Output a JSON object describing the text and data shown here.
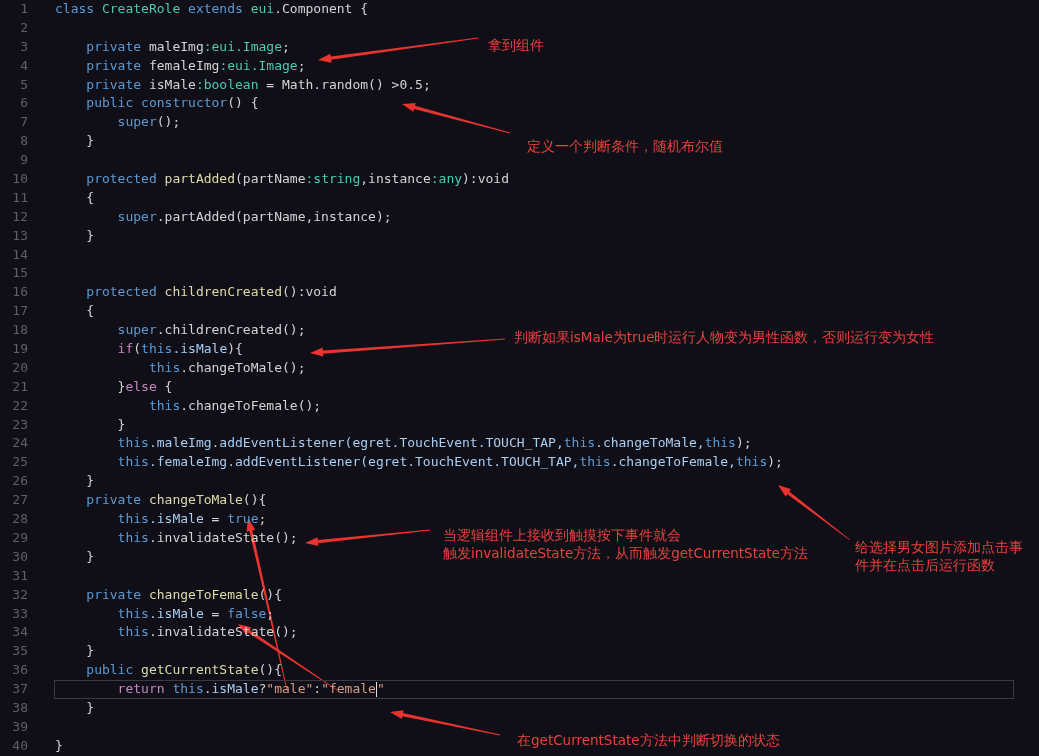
{
  "editor": {
    "lines": [
      {
        "number": "1",
        "current": false,
        "tokens": [
          {
            "kind": "keyword",
            "text": "class"
          },
          {
            "kind": "type",
            "text": " CreateRole"
          },
          {
            "kind": "keyword",
            "text": " extends"
          },
          {
            "kind": "type",
            "text": " eui"
          },
          {
            "kind": "plain",
            "text": ".Component {"
          }
        ]
      },
      {
        "number": "2",
        "current": false
      },
      {
        "number": "3",
        "current": false,
        "tokens": [
          {
            "kind": "keyword",
            "text": "    private"
          },
          {
            "kind": "plain",
            "text": " maleImg"
          },
          {
            "kind": "type",
            "text": ":eui.Image"
          },
          {
            "kind": "plain",
            "text": ";"
          }
        ]
      },
      {
        "number": "4",
        "current": false,
        "tokens": [
          {
            "kind": "keyword",
            "text": "    private"
          },
          {
            "kind": "plain",
            "text": " femaleImg"
          },
          {
            "kind": "type",
            "text": ":eui.Image"
          },
          {
            "kind": "plain",
            "text": ";"
          }
        ]
      },
      {
        "number": "5",
        "current": false,
        "tokens": [
          {
            "kind": "keyword",
            "text": "    private"
          },
          {
            "kind": "plain",
            "text": " isMale"
          },
          {
            "kind": "type",
            "text": ":boolean"
          },
          {
            "kind": "plain",
            "text": " = Math.random() >0.5;"
          }
        ]
      },
      {
        "number": "6",
        "current": false,
        "tokens": [
          {
            "kind": "keyword",
            "text": "    public constructor"
          },
          {
            "kind": "plain",
            "text": "() {"
          }
        ]
      },
      {
        "number": "7",
        "current": false,
        "tokens": [
          {
            "kind": "keyword",
            "text": "        super"
          },
          {
            "kind": "plain",
            "text": "();"
          }
        ]
      },
      {
        "number": "8",
        "current": false,
        "tokens": [
          {
            "kind": "plain",
            "text": "    }"
          }
        ]
      },
      {
        "number": "9",
        "current": false
      },
      {
        "number": "10",
        "current": false,
        "tokens": [
          {
            "kind": "keyword",
            "text": "    protected"
          },
          {
            "kind": "function",
            "text": " partAdded"
          },
          {
            "kind": "plain",
            "text": "(partName"
          },
          {
            "kind": "type",
            "text": ":string"
          },
          {
            "kind": "plain",
            "text": ",instance"
          },
          {
            "kind": "type",
            "text": ":any"
          },
          {
            "kind": "plain",
            "text": "):void"
          }
        ]
      },
      {
        "number": "11",
        "current": false,
        "tokens": [
          {
            "kind": "plain",
            "text": "    {"
          }
        ]
      },
      {
        "number": "12",
        "current": false,
        "tokens": [
          {
            "kind": "keyword",
            "text": "        super"
          },
          {
            "kind": "plain",
            "text": ".partAdded(partName,instance);"
          }
        ]
      },
      {
        "number": "13",
        "current": false,
        "tokens": [
          {
            "kind": "plain",
            "text": "    }"
          }
        ]
      },
      {
        "number": "14",
        "current": false
      },
      {
        "number": "15",
        "current": false
      },
      {
        "number": "16",
        "current": false,
        "tokens": [
          {
            "kind": "keyword",
            "text": "    protected"
          },
          {
            "kind": "function",
            "text": " childrenCreated"
          },
          {
            "kind": "plain",
            "text": "():void"
          }
        ]
      },
      {
        "number": "17",
        "current": false,
        "tokens": [
          {
            "kind": "plain",
            "text": "    {"
          }
        ]
      },
      {
        "number": "18",
        "current": false,
        "tokens": [
          {
            "kind": "keyword",
            "text": "        super"
          },
          {
            "kind": "plain",
            "text": ".childrenCreated();"
          }
        ]
      },
      {
        "number": "19",
        "current": false,
        "tokens": [
          {
            "kind": "control",
            "text": "        if"
          },
          {
            "kind": "plain",
            "text": "("
          },
          {
            "kind": "keyword",
            "text": "this"
          },
          {
            "kind": "variable",
            "text": ".isMale"
          },
          {
            "kind": "plain",
            "text": "){"
          }
        ]
      },
      {
        "number": "20",
        "current": false,
        "tokens": [
          {
            "kind": "keyword",
            "text": "            this"
          },
          {
            "kind": "plain",
            "text": ".changeToMale();"
          }
        ]
      },
      {
        "number": "21",
        "current": false,
        "tokens": [
          {
            "kind": "plain",
            "text": "        }"
          },
          {
            "kind": "control",
            "text": "else"
          },
          {
            "kind": "plain",
            "text": " {"
          }
        ]
      },
      {
        "number": "22",
        "current": false,
        "tokens": [
          {
            "kind": "keyword",
            "text": "            this"
          },
          {
            "kind": "plain",
            "text": ".changeToFemale();"
          }
        ]
      },
      {
        "number": "23",
        "current": false,
        "tokens": [
          {
            "kind": "plain",
            "text": "        }"
          }
        ]
      },
      {
        "number": "24",
        "current": false,
        "tokens": [
          {
            "kind": "keyword",
            "text": "        this"
          },
          {
            "kind": "variable",
            "text": ".maleImg.addEventListener(egret.TouchEvent.TOUCH_TAP,"
          },
          {
            "kind": "keyword",
            "text": "this"
          },
          {
            "kind": "variable",
            "text": ".changeToMale,"
          },
          {
            "kind": "keyword",
            "text": "this"
          },
          {
            "kind": "plain",
            "text": ");"
          }
        ]
      },
      {
        "number": "25",
        "current": false,
        "tokens": [
          {
            "kind": "keyword",
            "text": "        this"
          },
          {
            "kind": "variable",
            "text": ".femaleImg.addEventListener(egret.TouchEvent.TOUCH_TAP,"
          },
          {
            "kind": "keyword",
            "text": "this"
          },
          {
            "kind": "variable",
            "text": ".changeToFemale,"
          },
          {
            "kind": "keyword",
            "text": "this"
          },
          {
            "kind": "plain",
            "text": ");"
          }
        ]
      },
      {
        "number": "26",
        "current": false,
        "tokens": [
          {
            "kind": "plain",
            "text": "    }"
          }
        ]
      },
      {
        "number": "27",
        "current": false,
        "tokens": [
          {
            "kind": "keyword",
            "text": "    private"
          },
          {
            "kind": "function",
            "text": " changeToMale"
          },
          {
            "kind": "plain",
            "text": "(){"
          }
        ]
      },
      {
        "number": "28",
        "current": false,
        "tokens": [
          {
            "kind": "keyword",
            "text": "        this"
          },
          {
            "kind": "variable",
            "text": ".isMale"
          },
          {
            "kind": "plain",
            "text": " ="
          },
          {
            "kind": "keyword",
            "text": " true"
          },
          {
            "kind": "plain",
            "text": ";"
          }
        ]
      },
      {
        "number": "29",
        "current": false,
        "tokens": [
          {
            "kind": "keyword",
            "text": "        this"
          },
          {
            "kind": "plain",
            "text": ".invalidateState();"
          }
        ]
      },
      {
        "number": "30",
        "current": false,
        "tokens": [
          {
            "kind": "plain",
            "text": "    }"
          }
        ]
      },
      {
        "number": "31",
        "current": false
      },
      {
        "number": "32",
        "current": false,
        "tokens": [
          {
            "kind": "keyword",
            "text": "    private"
          },
          {
            "kind": "function",
            "text": " changeToFemale"
          },
          {
            "kind": "plain",
            "text": "(){"
          }
        ]
      },
      {
        "number": "33",
        "current": false,
        "tokens": [
          {
            "kind": "keyword",
            "text": "        this"
          },
          {
            "kind": "variable",
            "text": ".isMale"
          },
          {
            "kind": "plain",
            "text": " ="
          },
          {
            "kind": "keyword",
            "text": " false"
          },
          {
            "kind": "plain",
            "text": ";"
          }
        ]
      },
      {
        "number": "34",
        "current": false,
        "tokens": [
          {
            "kind": "keyword",
            "text": "        this"
          },
          {
            "kind": "plain",
            "text": ".invalidateState();"
          }
        ]
      },
      {
        "number": "35",
        "current": false,
        "tokens": [
          {
            "kind": "plain",
            "text": "    }"
          }
        ]
      },
      {
        "number": "36",
        "current": false,
        "tokens": [
          {
            "kind": "keyword",
            "text": "    public"
          },
          {
            "kind": "function",
            "text": " getCurrentState"
          },
          {
            "kind": "plain",
            "text": "(){"
          }
        ]
      },
      {
        "number": "37",
        "current": true,
        "tokens": [
          {
            "kind": "control",
            "text": "        return"
          },
          {
            "kind": "keyword",
            "text": " this"
          },
          {
            "kind": "variable",
            "text": ".isMale"
          },
          {
            "kind": "plain",
            "text": "?"
          },
          {
            "kind": "string",
            "text": "\"male\""
          },
          {
            "kind": "plain",
            "text": ":"
          },
          {
            "kind": "string",
            "text": "\"female"
          },
          {
            "kind": "caret"
          },
          {
            "kind": "string",
            "text": "\""
          }
        ]
      },
      {
        "number": "38",
        "current": false,
        "tokens": [
          {
            "kind": "plain",
            "text": "    }"
          }
        ]
      },
      {
        "number": "39",
        "current": false
      },
      {
        "number": "40",
        "current": false,
        "tokens": [
          {
            "kind": "plain",
            "text": "}"
          }
        ]
      }
    ]
  },
  "annotations": [
    {
      "lines": [
        "拿到组件"
      ]
    },
    {
      "lines": [
        "定义一个判断条件，随机布尔值"
      ]
    },
    {
      "lines": [
        "判断如果isMale为true时运行人物变为男性函数，否则运行变为女性"
      ]
    },
    {
      "lines": [
        "当逻辑组件上接收到触摸按下事件就会",
        "触发invalidateState方法，从而触发getCurrentState方法"
      ]
    },
    {
      "lines": [
        "给选择男女图片添加点击事",
        "件并在点击后运行函数"
      ]
    },
    {
      "lines": [
        "在getCurrentState方法中判断切换的状态"
      ]
    }
  ]
}
